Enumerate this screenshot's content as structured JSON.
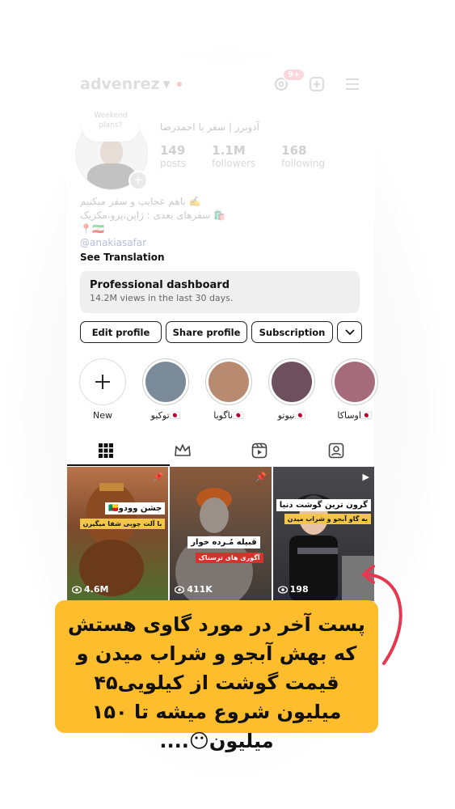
{
  "profile": {
    "username": "advenrez",
    "full_name": "آدونرز | سفر با احمدرضا",
    "note": "Weekend plans?",
    "stats": [
      {
        "value": "149",
        "label": "posts"
      },
      {
        "value": "1.1M",
        "label": "followers"
      },
      {
        "value": "168",
        "label": "following"
      }
    ],
    "bio_lines": [
      "باهم عجایب و سفر میکنیم ✍️",
      "سفرهای بعدی : ژاپن،پرو،مکزیک 🛍️",
      "📍🇮🇷"
    ],
    "bio_link": "@anakiasafar",
    "see_translation": "See Translation"
  },
  "topbar": {
    "notification_badge": "9+"
  },
  "dashboard": {
    "title": "Professional dashboard",
    "subtitle": "14.2M views in the last 30 days."
  },
  "buttons": {
    "edit": "Edit profile",
    "share": "Share profile",
    "subscription": "Subscription"
  },
  "highlights": [
    {
      "label": "New"
    },
    {
      "label": "توکیو🇯🇵",
      "color": "#7b8a99"
    },
    {
      "label": "ناگویا🇯🇵",
      "color": "#b88a6f"
    },
    {
      "label": "نیوتو🇯🇵",
      "color": "#6e4f5c"
    },
    {
      "label": "اوساکا🇯🇵",
      "color": "#a66b7a"
    }
  ],
  "posts": [
    {
      "caption": "جشن وودو🇧🇯",
      "subcaption": "با آلت چوبی شفا میگیرن",
      "views": "4.6M",
      "bg": "#5d7a3a"
    },
    {
      "caption": "قبیله مُـرده خوار",
      "subcaption": "آگوری های ترسناک",
      "views": "411K",
      "bg": "#6b5b4c"
    },
    {
      "caption": "گرون ترین گوشت دنیا",
      "subcaption": "به گاو آبجو و شراب میدن",
      "views": "198",
      "bg": "#3a3a3e"
    }
  ],
  "callout": {
    "text": "پست آخر در مورد گاوی هستش که بهش آبجو و شراب میدن و قیمت گوشت از کیلویی۴۵ میلیون شروع میشه تا ۱۵۰ میلیون😶...."
  },
  "colors": {
    "callout_bg": "#fdbd2c",
    "arrow": "#e8364f"
  }
}
